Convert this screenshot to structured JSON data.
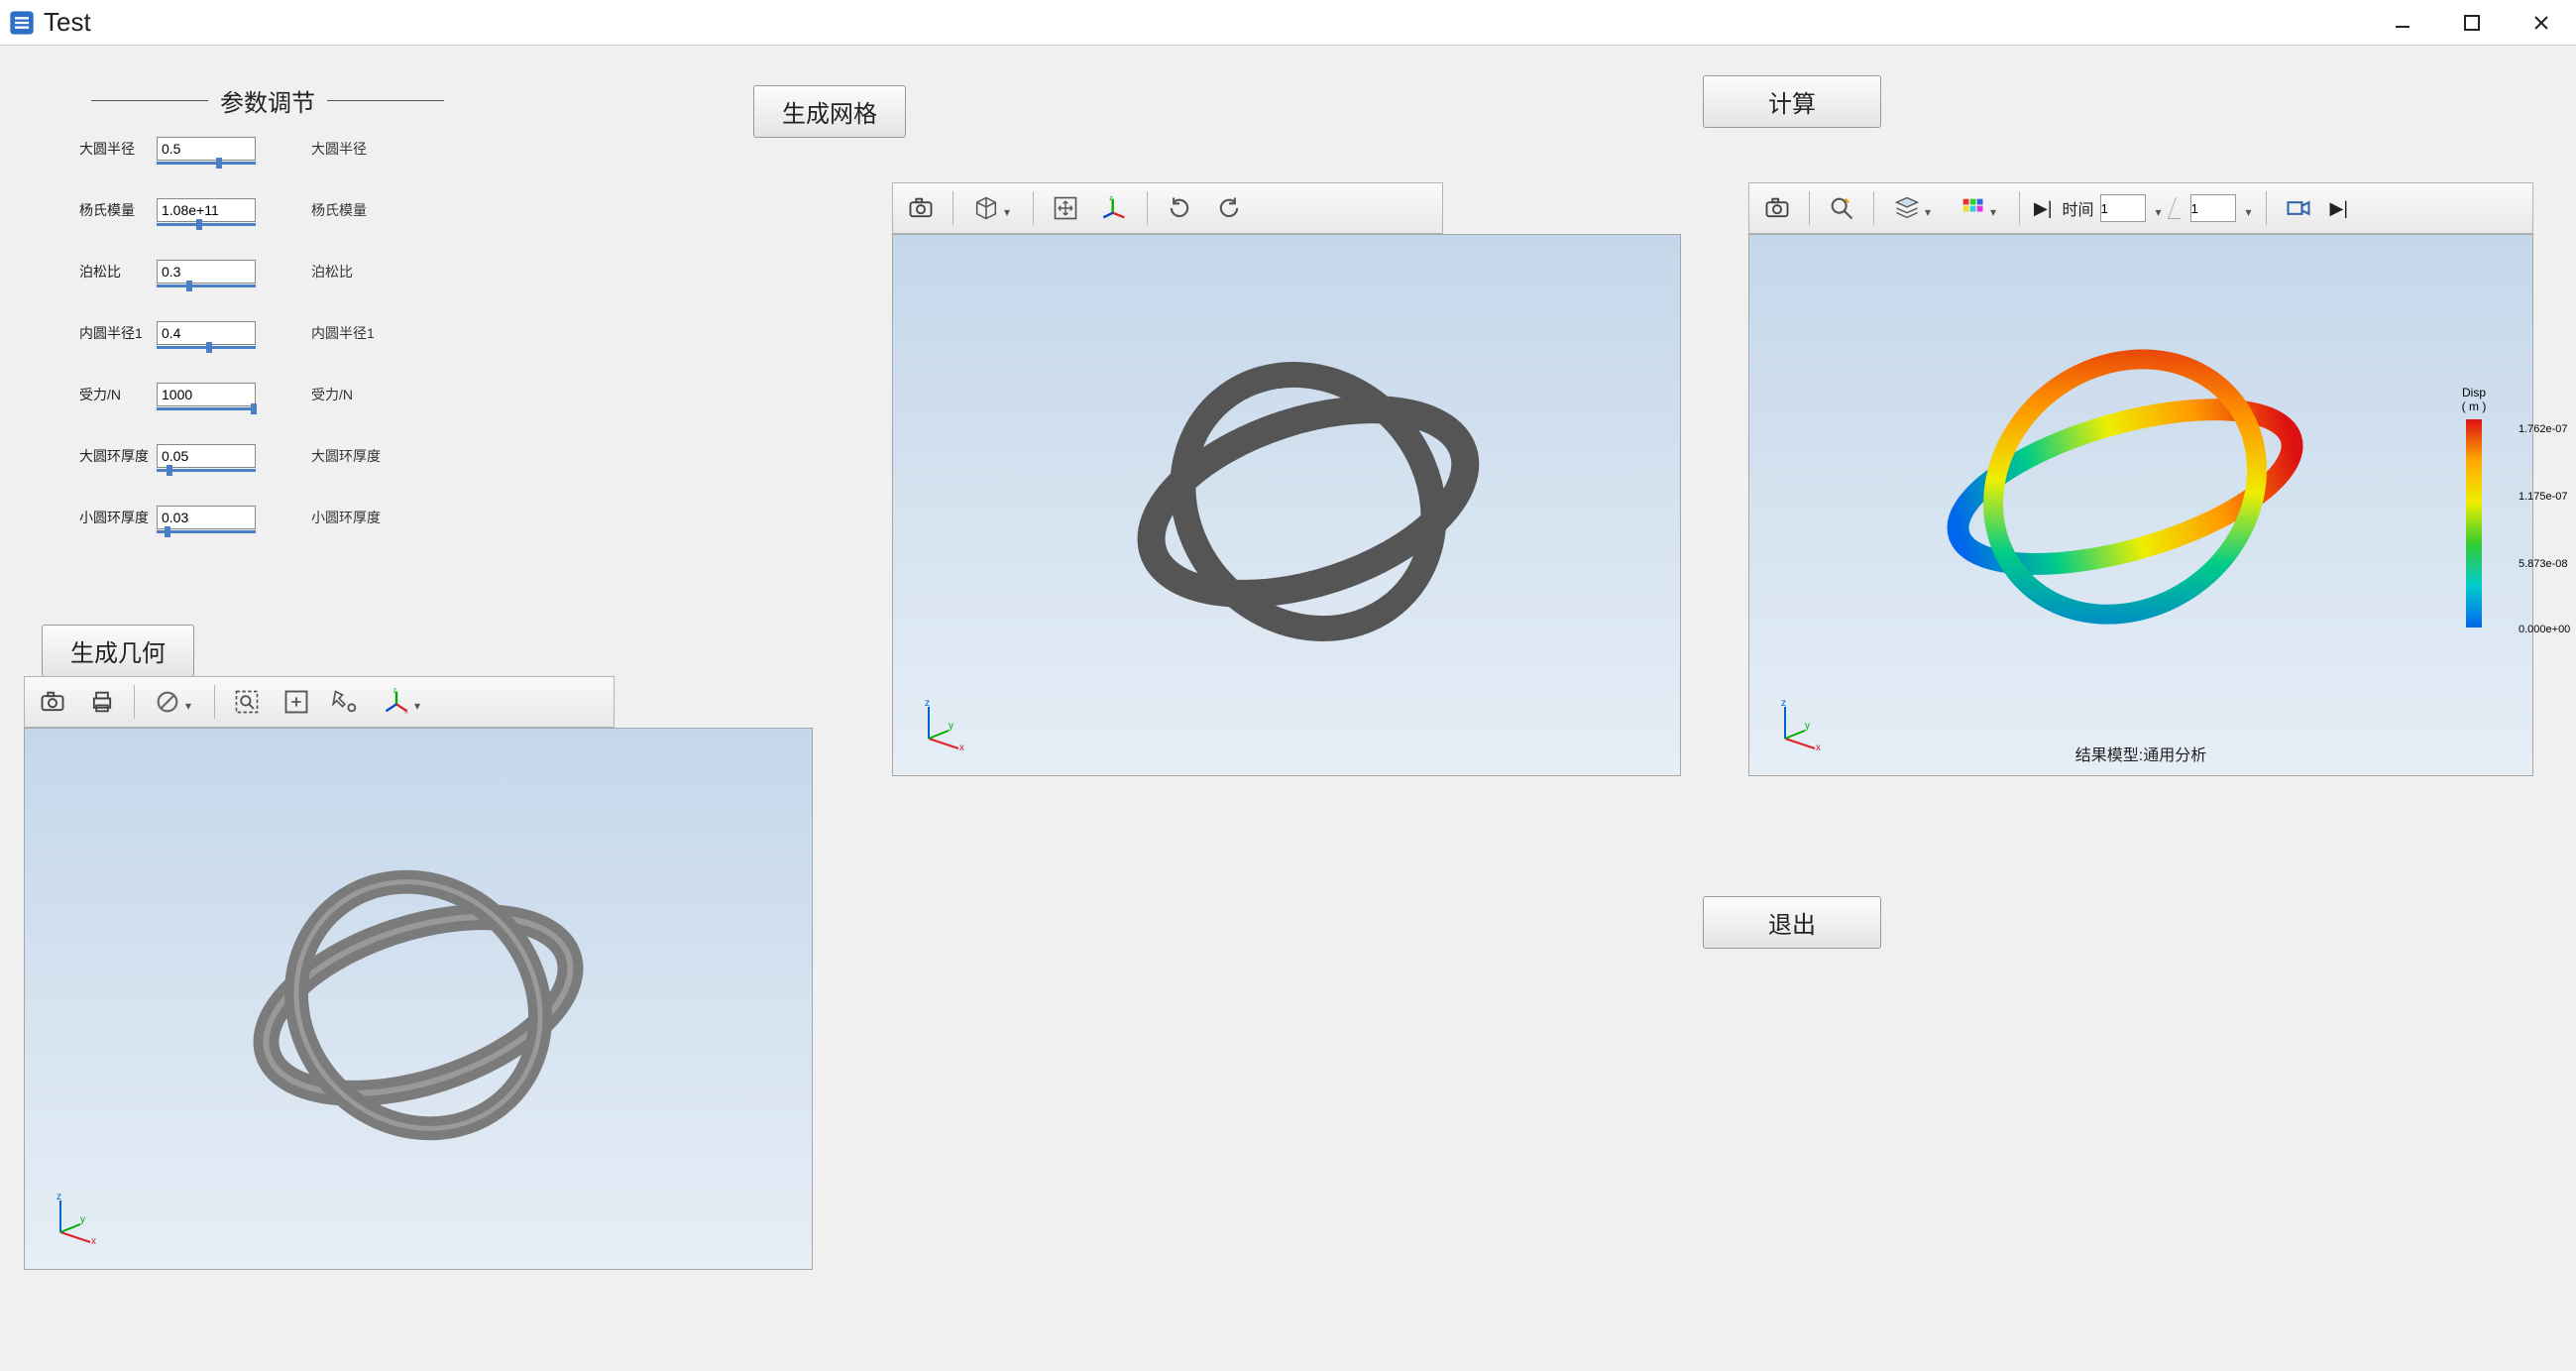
{
  "window": {
    "title": "Test"
  },
  "params": {
    "header": "参数调节",
    "rows": [
      {
        "label": "大圆半径",
        "value": "0.5",
        "side": "大圆半径",
        "knob": 60
      },
      {
        "label": "杨氏模量",
        "value": "1.08e+11",
        "side": "杨氏模量",
        "knob": 40
      },
      {
        "label": "泊松比",
        "value": "0.3",
        "side": "泊松比",
        "knob": 30
      },
      {
        "label": "内圆半径1",
        "value": "0.4",
        "side": "内圆半径1",
        "knob": 50
      },
      {
        "label": "受力/N",
        "value": "1000",
        "side": "受力/N",
        "knob": 95
      },
      {
        "label": "大圆环厚度",
        "value": "0.05",
        "side": "大圆环厚度",
        "knob": 10
      },
      {
        "label": "小圆环厚度",
        "value": "0.03",
        "side": "小圆环厚度",
        "knob": 8
      }
    ]
  },
  "buttons": {
    "gen_geom": "生成几何",
    "gen_mesh": "生成网格",
    "compute": "计算",
    "exit": "退出"
  },
  "result": {
    "caption": "结果模型:通用分析",
    "legend_title1": "Disp",
    "legend_title2": "( m )",
    "ticks": [
      "1.762e-07",
      "1.175e-07",
      "5.873e-08",
      "0.000e+00"
    ]
  },
  "time": {
    "label": "时间",
    "value1": "1",
    "value2": "1"
  }
}
